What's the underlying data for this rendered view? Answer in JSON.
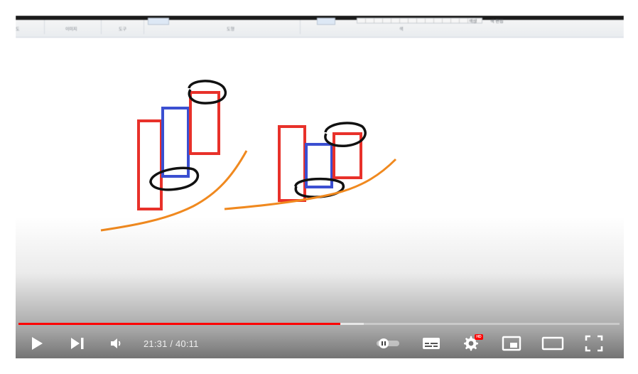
{
  "ribbon": {
    "sections": [
      "도",
      "이미지",
      "도구",
      "도형",
      "색"
    ],
    "right_labels": [
      "색상",
      "색 편집"
    ]
  },
  "player": {
    "time_display": "21:31 / 40:11",
    "progress": {
      "played": 0.5357,
      "loaded": 0.575
    },
    "badges": {
      "hd": "HD"
    },
    "icons": {
      "play": "play-icon",
      "next": "next-icon",
      "volume": "volume-icon",
      "autoplay": "autoplay-toggle-icon",
      "subtitles": "subtitles-icon",
      "settings": "gear-icon",
      "miniplayer": "miniplayer-icon",
      "theater": "theater-mode-icon",
      "fullscreen": "fullscreen-icon"
    },
    "colors": {
      "accent": "#ff0000",
      "control": "#ffffff"
    }
  },
  "drawing": {
    "colors": {
      "red": "#e8312a",
      "blue": "#3b4fd1",
      "black": "#111111",
      "orange": "#f0891f"
    }
  }
}
